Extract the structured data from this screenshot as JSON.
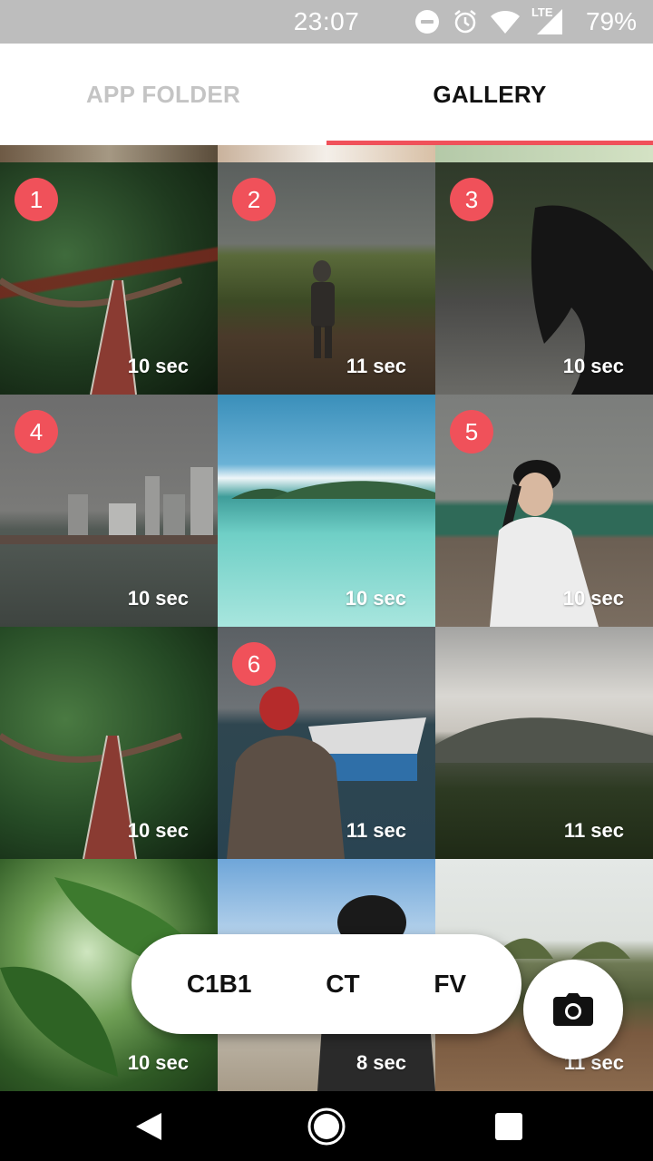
{
  "status_bar": {
    "time": "23:07",
    "network_label": "LTE",
    "battery": "79%",
    "icons": [
      "dnd-icon",
      "alarm-icon",
      "wifi-icon",
      "cellular-icon",
      "battery-icon"
    ]
  },
  "tabs": [
    {
      "label": "APP FOLDER",
      "active": false
    },
    {
      "label": "GALLERY",
      "active": true
    }
  ],
  "accent_color": "#f0515a",
  "tiles": [
    {
      "badge": "1",
      "duration": "10 sec",
      "scene": "jungle-bridge"
    },
    {
      "badge": "2",
      "duration": "11 sec",
      "scene": "hiker-hilltop"
    },
    {
      "badge": "3",
      "duration": "10 sec",
      "scene": "horse"
    },
    {
      "badge": "4",
      "duration": "10 sec",
      "scene": "city-waterfront"
    },
    {
      "badge": "",
      "duration": "10 sec",
      "scene": "tropical-sea"
    },
    {
      "badge": "5",
      "duration": "10 sec",
      "scene": "woman-cap"
    },
    {
      "badge": "",
      "duration": "10 sec",
      "scene": "jungle-bridge"
    },
    {
      "badge": "6",
      "duration": "11 sec",
      "scene": "man-boat"
    },
    {
      "badge": "",
      "duration": "11 sec",
      "scene": "mountain-clouds"
    },
    {
      "badge": "",
      "duration": "10 sec",
      "scene": "palm-leaves"
    },
    {
      "badge": "",
      "duration": "8 sec",
      "scene": "cap-closeup"
    },
    {
      "badge": "",
      "duration": "11 sec",
      "scene": "hills-walker"
    }
  ],
  "action_pill": {
    "items": [
      "C1B1",
      "CT",
      "FV"
    ]
  },
  "camera_button": {
    "icon": "camera-icon"
  },
  "nav_bar": {
    "icons": [
      "back-icon",
      "home-icon",
      "recents-icon"
    ]
  }
}
